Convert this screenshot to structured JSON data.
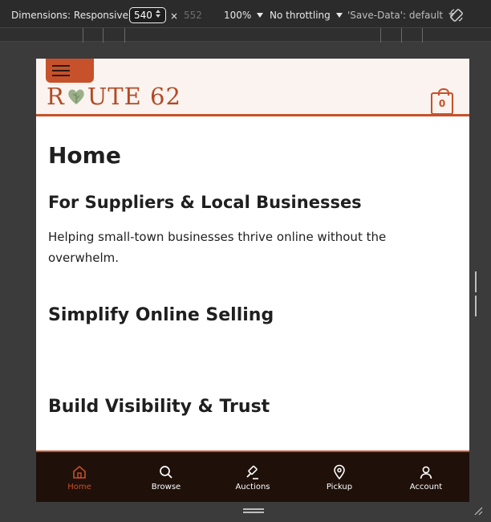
{
  "devtools": {
    "dimensions_label": "Dimensions: Responsive",
    "width_value": "540",
    "times": "×",
    "height_value": "552",
    "zoom": "100%",
    "throttling": "No throttling",
    "save_data": "'Save-Data': default"
  },
  "site": {
    "logo_text_a": "R",
    "logo_text_b": "UTE 62",
    "cart_count": "0",
    "accent_color": "#c7512a"
  },
  "page": {
    "title": "Home",
    "subtitle": "For Suppliers & Local Businesses",
    "intro": "Helping small-town businesses thrive online without the overwhelm.",
    "section1": "Simplify Online Selling",
    "section2": "Build Visibility & Trust"
  },
  "bottom_nav": {
    "home": "Home",
    "browse": "Browse",
    "auctions": "Auctions",
    "pickup": "Pickup",
    "account": "Account"
  }
}
